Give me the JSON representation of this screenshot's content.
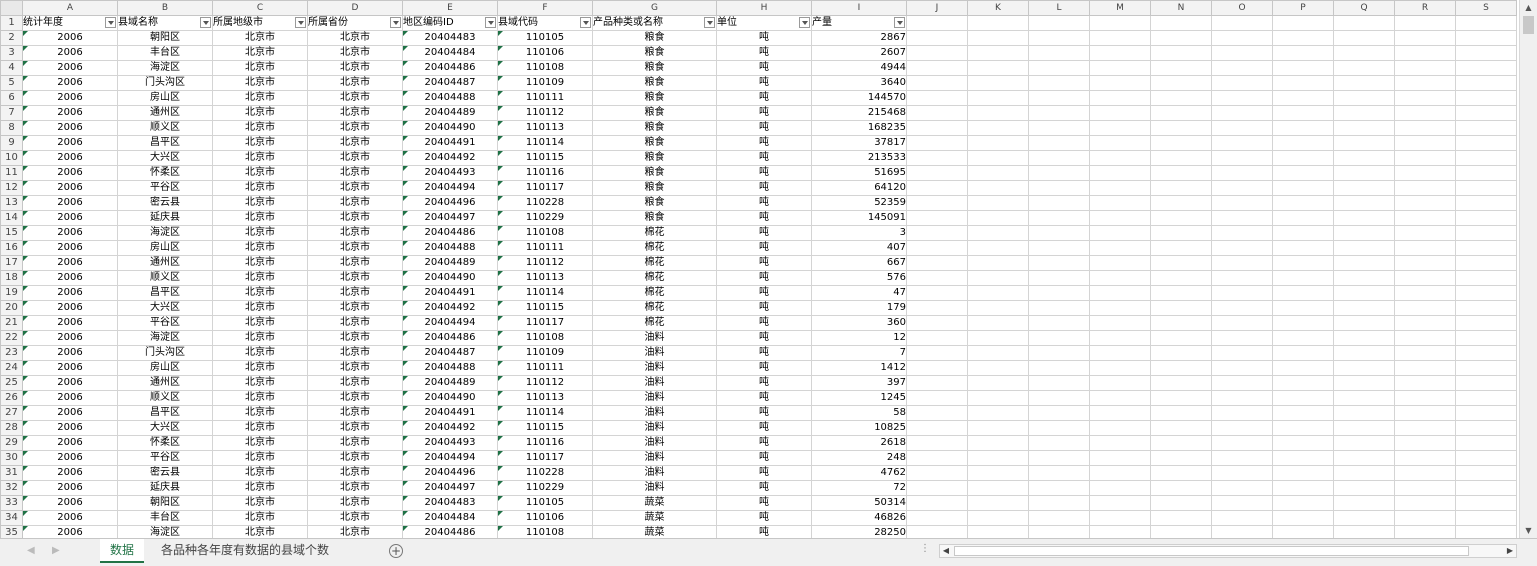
{
  "columns": [
    "A",
    "B",
    "C",
    "D",
    "E",
    "F",
    "G",
    "H",
    "I",
    "J",
    "K",
    "L",
    "M",
    "N",
    "O",
    "P",
    "Q",
    "R",
    "S"
  ],
  "headers": [
    "统计年度",
    "县域名称",
    "所属地级市",
    "所属省份",
    "地区编码ID",
    "县域代码",
    "产品种类或名称",
    "单位",
    "产量"
  ],
  "rows": [
    [
      "2006",
      "朝阳区",
      "北京市",
      "北京市",
      "20404483",
      "110105",
      "粮食",
      "吨",
      "2867"
    ],
    [
      "2006",
      "丰台区",
      "北京市",
      "北京市",
      "20404484",
      "110106",
      "粮食",
      "吨",
      "2607"
    ],
    [
      "2006",
      "海淀区",
      "北京市",
      "北京市",
      "20404486",
      "110108",
      "粮食",
      "吨",
      "4944"
    ],
    [
      "2006",
      "门头沟区",
      "北京市",
      "北京市",
      "20404487",
      "110109",
      "粮食",
      "吨",
      "3640"
    ],
    [
      "2006",
      "房山区",
      "北京市",
      "北京市",
      "20404488",
      "110111",
      "粮食",
      "吨",
      "144570"
    ],
    [
      "2006",
      "通州区",
      "北京市",
      "北京市",
      "20404489",
      "110112",
      "粮食",
      "吨",
      "215468"
    ],
    [
      "2006",
      "顺义区",
      "北京市",
      "北京市",
      "20404490",
      "110113",
      "粮食",
      "吨",
      "168235"
    ],
    [
      "2006",
      "昌平区",
      "北京市",
      "北京市",
      "20404491",
      "110114",
      "粮食",
      "吨",
      "37817"
    ],
    [
      "2006",
      "大兴区",
      "北京市",
      "北京市",
      "20404492",
      "110115",
      "粮食",
      "吨",
      "213533"
    ],
    [
      "2006",
      "怀柔区",
      "北京市",
      "北京市",
      "20404493",
      "110116",
      "粮食",
      "吨",
      "51695"
    ],
    [
      "2006",
      "平谷区",
      "北京市",
      "北京市",
      "20404494",
      "110117",
      "粮食",
      "吨",
      "64120"
    ],
    [
      "2006",
      "密云县",
      "北京市",
      "北京市",
      "20404496",
      "110228",
      "粮食",
      "吨",
      "52359"
    ],
    [
      "2006",
      "延庆县",
      "北京市",
      "北京市",
      "20404497",
      "110229",
      "粮食",
      "吨",
      "145091"
    ],
    [
      "2006",
      "海淀区",
      "北京市",
      "北京市",
      "20404486",
      "110108",
      "棉花",
      "吨",
      "3"
    ],
    [
      "2006",
      "房山区",
      "北京市",
      "北京市",
      "20404488",
      "110111",
      "棉花",
      "吨",
      "407"
    ],
    [
      "2006",
      "通州区",
      "北京市",
      "北京市",
      "20404489",
      "110112",
      "棉花",
      "吨",
      "667"
    ],
    [
      "2006",
      "顺义区",
      "北京市",
      "北京市",
      "20404490",
      "110113",
      "棉花",
      "吨",
      "576"
    ],
    [
      "2006",
      "昌平区",
      "北京市",
      "北京市",
      "20404491",
      "110114",
      "棉花",
      "吨",
      "47"
    ],
    [
      "2006",
      "大兴区",
      "北京市",
      "北京市",
      "20404492",
      "110115",
      "棉花",
      "吨",
      "179"
    ],
    [
      "2006",
      "平谷区",
      "北京市",
      "北京市",
      "20404494",
      "110117",
      "棉花",
      "吨",
      "360"
    ],
    [
      "2006",
      "海淀区",
      "北京市",
      "北京市",
      "20404486",
      "110108",
      "油料",
      "吨",
      "12"
    ],
    [
      "2006",
      "门头沟区",
      "北京市",
      "北京市",
      "20404487",
      "110109",
      "油料",
      "吨",
      "7"
    ],
    [
      "2006",
      "房山区",
      "北京市",
      "北京市",
      "20404488",
      "110111",
      "油料",
      "吨",
      "1412"
    ],
    [
      "2006",
      "通州区",
      "北京市",
      "北京市",
      "20404489",
      "110112",
      "油料",
      "吨",
      "397"
    ],
    [
      "2006",
      "顺义区",
      "北京市",
      "北京市",
      "20404490",
      "110113",
      "油料",
      "吨",
      "1245"
    ],
    [
      "2006",
      "昌平区",
      "北京市",
      "北京市",
      "20404491",
      "110114",
      "油料",
      "吨",
      "58"
    ],
    [
      "2006",
      "大兴区",
      "北京市",
      "北京市",
      "20404492",
      "110115",
      "油料",
      "吨",
      "10825"
    ],
    [
      "2006",
      "怀柔区",
      "北京市",
      "北京市",
      "20404493",
      "110116",
      "油料",
      "吨",
      "2618"
    ],
    [
      "2006",
      "平谷区",
      "北京市",
      "北京市",
      "20404494",
      "110117",
      "油料",
      "吨",
      "248"
    ],
    [
      "2006",
      "密云县",
      "北京市",
      "北京市",
      "20404496",
      "110228",
      "油料",
      "吨",
      "4762"
    ],
    [
      "2006",
      "延庆县",
      "北京市",
      "北京市",
      "20404497",
      "110229",
      "油料",
      "吨",
      "72"
    ],
    [
      "2006",
      "朝阳区",
      "北京市",
      "北京市",
      "20404483",
      "110105",
      "蔬菜",
      "吨",
      "50314"
    ],
    [
      "2006",
      "丰台区",
      "北京市",
      "北京市",
      "20404484",
      "110106",
      "蔬菜",
      "吨",
      "46826"
    ],
    [
      "2006",
      "海淀区",
      "北京市",
      "北京市",
      "20404486",
      "110108",
      "蔬菜",
      "吨",
      "28250"
    ]
  ],
  "sheets": [
    {
      "label": "数据",
      "active": true
    },
    {
      "label": "各品种各年度有数据的县域个数",
      "active": false
    }
  ],
  "icons": {
    "filter": "filter-dropdown-icon",
    "add_sheet": "plus-icon",
    "scroll_up": "up-arrow-icon",
    "scroll_down": "down-arrow-icon",
    "scroll_left": "left-arrow-icon",
    "scroll_right": "right-arrow-icon"
  },
  "colors": {
    "accent": "#217346",
    "error_indicator": "#1e7145"
  }
}
